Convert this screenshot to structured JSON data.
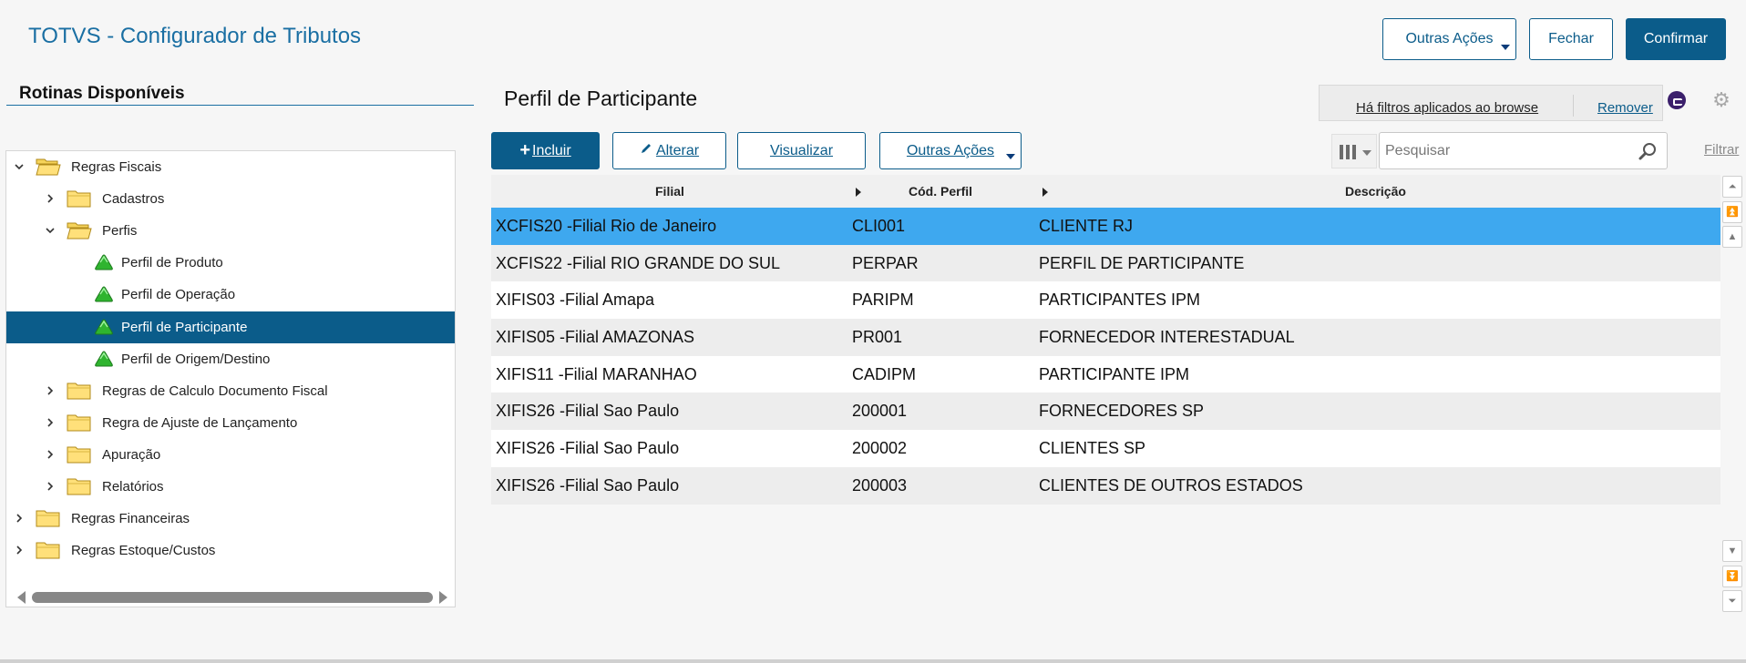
{
  "app": {
    "title": "TOTVS - Configurador de Tributos"
  },
  "top_actions": {
    "other_actions": "Outras Ações",
    "close": "Fechar",
    "confirm": "Confirmar"
  },
  "left_panel": {
    "title": "Rotinas Disponíveis",
    "tree": [
      {
        "label": "Regras Fiscais",
        "level": 0,
        "expanded": true,
        "type": "folder"
      },
      {
        "label": "Cadastros",
        "level": 1,
        "expanded": false,
        "type": "folder"
      },
      {
        "label": "Perfis",
        "level": 1,
        "expanded": true,
        "type": "folder"
      },
      {
        "label": "Perfil de Produto",
        "level": 2,
        "type": "leaf"
      },
      {
        "label": "Perfil de Operação",
        "level": 2,
        "type": "leaf"
      },
      {
        "label": "Perfil de Participante",
        "level": 2,
        "type": "leaf",
        "selected": true
      },
      {
        "label": "Perfil de Origem/Destino",
        "level": 2,
        "type": "leaf"
      },
      {
        "label": "Regras de Calculo Documento Fiscal",
        "level": 1,
        "expanded": false,
        "type": "folder"
      },
      {
        "label": "Regra de Ajuste de Lançamento",
        "level": 1,
        "expanded": false,
        "type": "folder"
      },
      {
        "label": "Apuração",
        "level": 1,
        "expanded": false,
        "type": "folder"
      },
      {
        "label": "Relatórios",
        "level": 1,
        "expanded": false,
        "type": "folder"
      },
      {
        "label": "Regras Financeiras",
        "level": 0,
        "expanded": false,
        "type": "folder"
      },
      {
        "label": "Regras Estoque/Custos",
        "level": 0,
        "expanded": false,
        "type": "folder"
      }
    ]
  },
  "main": {
    "title": "Perfil de Participante",
    "filter_notice": "Há filtros aplicados ao browse",
    "filter_remove": "Remover",
    "toolbar": {
      "include": "Incluir",
      "edit": "Alterar",
      "view": "Visualizar",
      "other_actions": "Outras Ações"
    },
    "search": {
      "placeholder": "Pesquisar",
      "value": ""
    },
    "filter_link": "Filtrar",
    "table": {
      "columns": [
        "Filial",
        "Cód. Perfil",
        "Descrição"
      ],
      "rows": [
        {
          "filial": "XCFIS20 -Filial Rio de Janeiro",
          "codigo": "CLI001",
          "descricao": "CLIENTE RJ",
          "selected": true
        },
        {
          "filial": "XCFIS22 -Filial RIO GRANDE DO SUL",
          "codigo": "PERPAR",
          "descricao": "PERFIL DE PARTICIPANTE"
        },
        {
          "filial": "XIFIS03 -Filial Amapa",
          "codigo": "PARIPM",
          "descricao": "PARTICIPANTES IPM"
        },
        {
          "filial": "XIFIS05 -Filial AMAZONAS",
          "codigo": "PR001",
          "descricao": "FORNECEDOR INTERESTADUAL"
        },
        {
          "filial": "XIFIS11 -Filial MARANHAO",
          "codigo": "CADIPM",
          "descricao": "PARTICIPANTE IPM"
        },
        {
          "filial": "XIFIS26 -Filial Sao Paulo",
          "codigo": "200001",
          "descricao": "FORNECEDORES SP"
        },
        {
          "filial": "XIFIS26 -Filial Sao Paulo",
          "codigo": "200002",
          "descricao": "CLIENTES SP"
        },
        {
          "filial": "XIFIS26 -Filial Sao Paulo",
          "codigo": "200003",
          "descricao": "CLIENTES DE OUTROS ESTADOS"
        }
      ]
    }
  },
  "colors": {
    "brand": "#0b5c8a",
    "title": "#1a6fa3",
    "row_selected": "#3ea8ef",
    "row_alt": "#ededed",
    "leaf_icon": "#2fb42f"
  },
  "icons": {
    "folder": "folder-icon",
    "leaf": "green-triangle-icon",
    "gear": "gear-icon",
    "search": "magnifier-icon",
    "columns": "columns-icon"
  }
}
